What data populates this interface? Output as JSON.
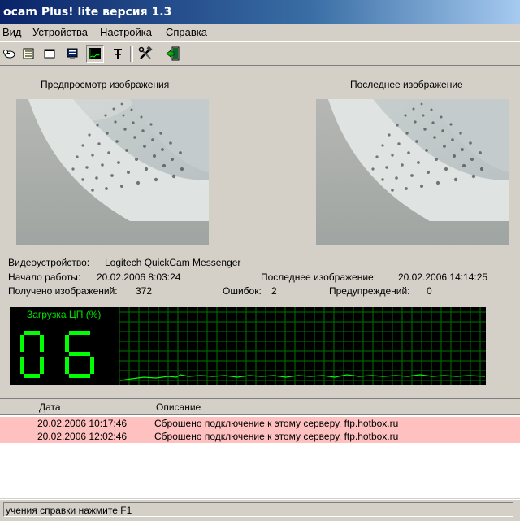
{
  "window": {
    "title": "ocam Plus! lite версия 1.3"
  },
  "menu": [
    {
      "label": "Вид"
    },
    {
      "label": "Устройства"
    },
    {
      "label": "Настройка"
    },
    {
      "label": "Справка"
    }
  ],
  "toolbar": {
    "icons": [
      "cow-icon",
      "list-icon",
      "window-icon",
      "monitor-icon",
      "graph-icon",
      "pin-icon",
      "tools-icon",
      "exit-icon"
    ],
    "pressed": "graph-icon"
  },
  "preview": {
    "left_label": "Предпросмотр изображения",
    "right_label": "Последнее изображение"
  },
  "info": {
    "device_label": "Видеоустройство:",
    "device_value": "Logitech QuickCam Messenger",
    "start_label": "Начало работы:",
    "start_value": "20.02.2006 8:03:24",
    "last_label": "Последнее изображение:",
    "last_value": "20.02.2006 14:14:25",
    "received_label": "Получено изображений:",
    "received_value": "372",
    "errors_label": "Ошибок:",
    "errors_value": "2",
    "warnings_label": "Предупреждений:",
    "warnings_value": "0"
  },
  "cpu": {
    "label": "Загрузка ЦП (%)",
    "value": "06",
    "color": "#00ff00"
  },
  "log": {
    "columns": [
      "",
      "Дата",
      "Описание"
    ],
    "rows": [
      {
        "date": "20.02.2006 10:17:46",
        "desc": "Сброшено подключение к этому серверу. ftp.hotbox.ru"
      },
      {
        "date": "20.02.2006 12:02:46",
        "desc": "Сброшено подключение к этому серверу. ftp.hotbox.ru"
      }
    ],
    "row_color": "#ffc0c0"
  },
  "status": {
    "text": "учения справки нажмите F1"
  }
}
